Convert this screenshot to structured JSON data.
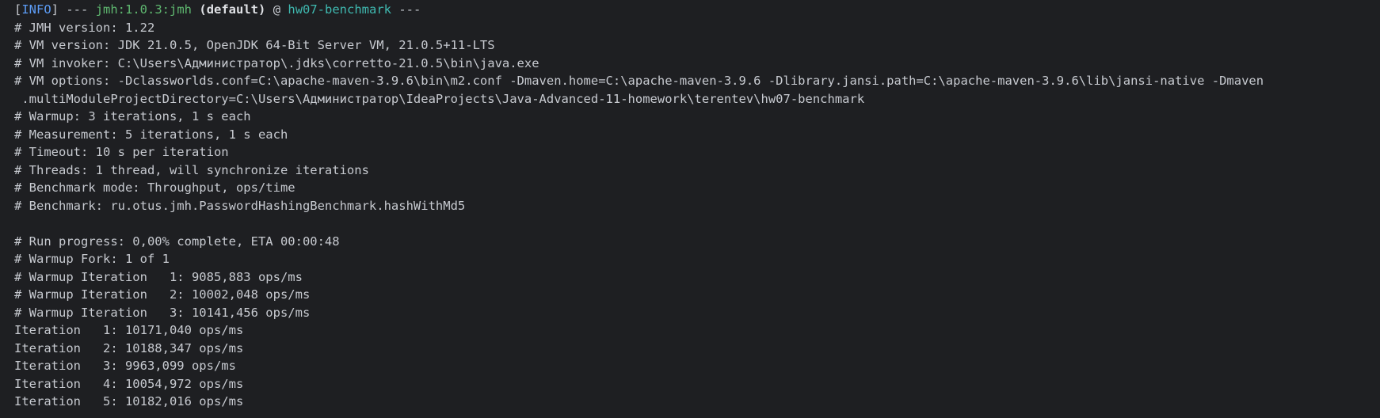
{
  "header": {
    "bracket_open": "[",
    "level": "INFO",
    "bracket_close": "]",
    "sep1": " --- ",
    "plugin": "jmh:1.0.3:jmh",
    "space": " ",
    "execution": "(default)",
    "at": " @ ",
    "project": "hw07-benchmark",
    "sep2": " ---"
  },
  "lines": [
    "# JMH version: 1.22",
    "# VM version: JDK 21.0.5, OpenJDK 64-Bit Server VM, 21.0.5+11-LTS",
    "# VM invoker: C:\\Users\\Администратор\\.jdks\\corretto-21.0.5\\bin\\java.exe",
    "# VM options: -Dclassworlds.conf=C:\\apache-maven-3.9.6\\bin\\m2.conf -Dmaven.home=C:\\apache-maven-3.9.6 -Dlibrary.jansi.path=C:\\apache-maven-3.9.6\\lib\\jansi-native -Dmaven",
    " .multiModuleProjectDirectory=C:\\Users\\Администратор\\IdeaProjects\\Java-Advanced-11-homework\\terentev\\hw07-benchmark",
    "# Warmup: 3 iterations, 1 s each",
    "# Measurement: 5 iterations, 1 s each",
    "# Timeout: 10 s per iteration",
    "# Threads: 1 thread, will synchronize iterations",
    "# Benchmark mode: Throughput, ops/time",
    "# Benchmark: ru.otus.jmh.PasswordHashingBenchmark.hashWithMd5",
    "",
    "# Run progress: 0,00% complete, ETA 00:00:48",
    "# Warmup Fork: 1 of 1",
    "# Warmup Iteration   1: 9085,883 ops/ms",
    "# Warmup Iteration   2: 10002,048 ops/ms",
    "# Warmup Iteration   3: 10141,456 ops/ms",
    "Iteration   1: 10171,040 ops/ms",
    "Iteration   2: 10188,347 ops/ms",
    "Iteration   3: 9963,099 ops/ms",
    "Iteration   4: 10054,972 ops/ms",
    "Iteration   5: 10182,016 ops/ms"
  ],
  "colors": {
    "background": "#1e1f22",
    "text": "#c7cad0",
    "info": "#5c9cf5",
    "plugin": "#5fb870",
    "project": "#3fb9b0"
  }
}
